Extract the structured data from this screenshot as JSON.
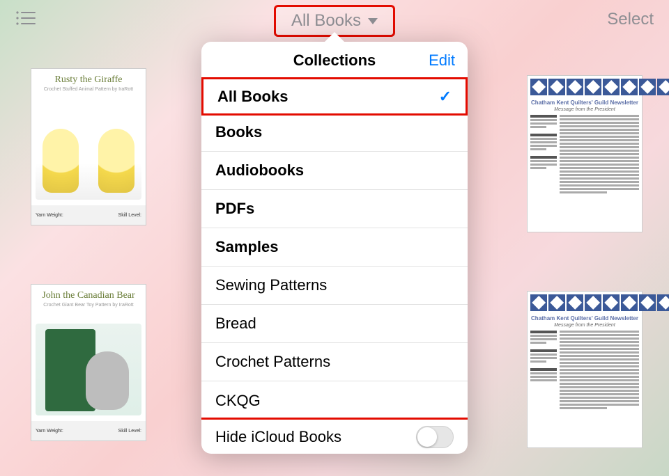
{
  "topbar": {
    "filter_label": "All Books",
    "select_label": "Select"
  },
  "popover": {
    "title": "Collections",
    "edit_label": "Edit",
    "items": [
      {
        "label": "All Books",
        "bold": true,
        "checked": true
      },
      {
        "label": "Books",
        "bold": true,
        "checked": false
      },
      {
        "label": "Audiobooks",
        "bold": true,
        "checked": false
      },
      {
        "label": "PDFs",
        "bold": true,
        "checked": false
      },
      {
        "label": "Samples",
        "bold": true,
        "checked": false
      },
      {
        "label": "Sewing Patterns",
        "bold": false,
        "checked": false
      },
      {
        "label": "Bread",
        "bold": false,
        "checked": false
      },
      {
        "label": "Crochet Patterns",
        "bold": false,
        "checked": false
      },
      {
        "label": "CKQG",
        "bold": false,
        "checked": false
      }
    ],
    "hide_icloud_label": "Hide iCloud Books",
    "hide_icloud_on": false
  },
  "books": {
    "b1": {
      "title": "Rusty the Giraffe",
      "sub": "Crochet Stuffed Animal Pattern by IraRott",
      "band_left": "Yarn Weight:",
      "band_right": "Skill Level:"
    },
    "b2": {
      "title": "John the Canadian Bear",
      "sub": "Crochet Giant Bear Toy Pattern by IraRott",
      "band_left": "Yarn Weight:",
      "band_right": "Skill Level:"
    },
    "b3": {
      "ht": "Chatham Kent Quilters' Guild Newsletter",
      "msg": "Message from the President"
    },
    "b4": {
      "ht": "Chatham Kent Quilters' Guild Newsletter",
      "msg": "Message from the President"
    }
  },
  "annotations": {
    "filter_highlighted": true,
    "first_row_highlighted": true,
    "toggle_row_highlighted": true
  }
}
